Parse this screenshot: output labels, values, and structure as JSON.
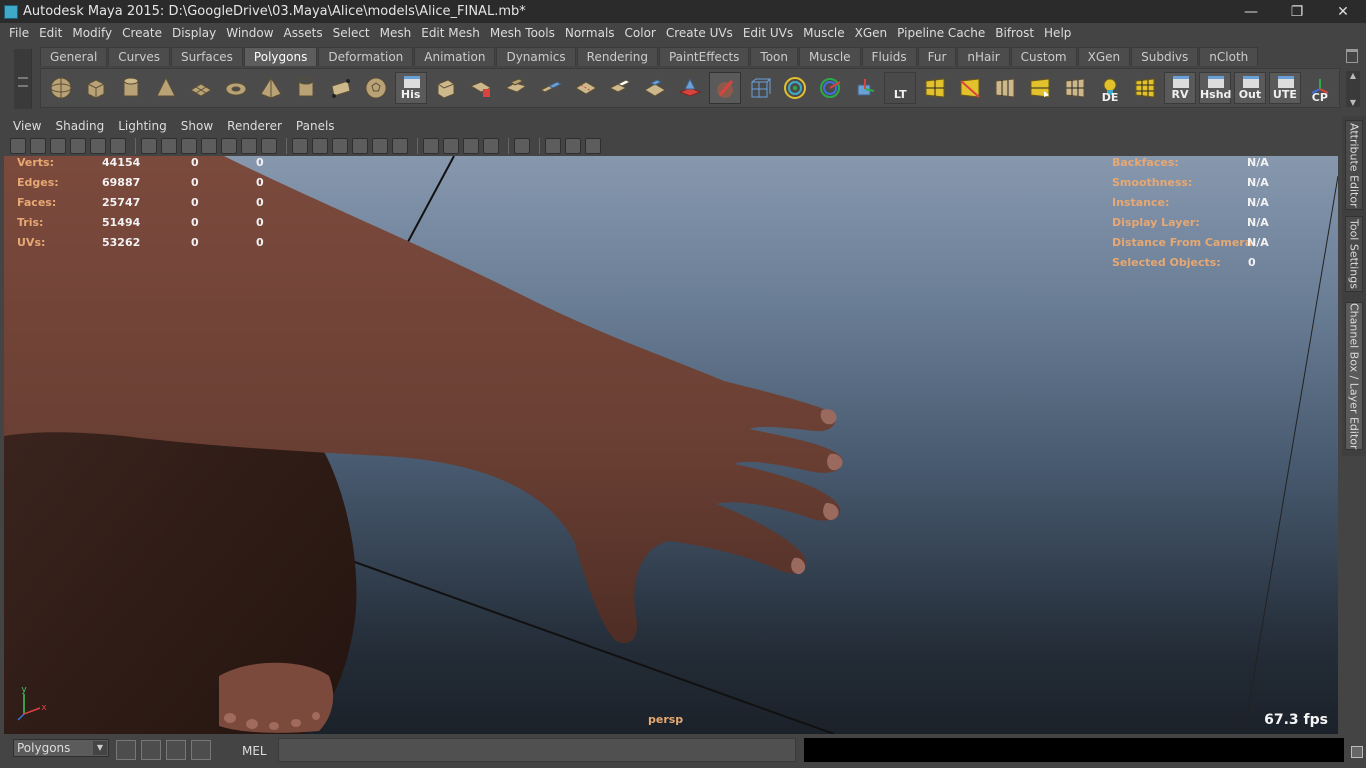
{
  "window": {
    "title": "Autodesk Maya 2015: D:\\GoogleDrive\\03.Maya\\Alice\\models\\Alice_FINAL.mb*",
    "minimize": "—",
    "maximize": "❐",
    "close": "✕"
  },
  "menubar": [
    "File",
    "Edit",
    "Modify",
    "Create",
    "Display",
    "Window",
    "Assets",
    "Select",
    "Mesh",
    "Edit Mesh",
    "Mesh Tools",
    "Normals",
    "Color",
    "Create UVs",
    "Edit UVs",
    "Muscle",
    "XGen",
    "Pipeline Cache",
    "Bifrost",
    "Help"
  ],
  "shelf": {
    "tabs": [
      "General",
      "Curves",
      "Surfaces",
      "Polygons",
      "Deformation",
      "Animation",
      "Dynamics",
      "Rendering",
      "PaintEffects",
      "Toon",
      "Muscle",
      "Fluids",
      "Fur",
      "nHair",
      "Custom",
      "XGen",
      "Subdivs",
      "nCloth"
    ],
    "active_tab": "Polygons",
    "tool_labels": {
      "his": "His",
      "lt": "LT",
      "de": "DE",
      "rv": "RV",
      "hshd": "Hshd",
      "out": "Out",
      "ute": "UTE",
      "cp": "CP"
    }
  },
  "panel": {
    "menus": [
      "View",
      "Shading",
      "Lighting",
      "Show",
      "Renderer",
      "Panels"
    ],
    "camera": "persp",
    "fps": "67.3 fps"
  },
  "hud": {
    "left": [
      {
        "label": "Verts:",
        "v1": "44154",
        "v2": "0",
        "v3": "0"
      },
      {
        "label": "Edges:",
        "v1": "69887",
        "v2": "0",
        "v3": "0"
      },
      {
        "label": "Faces:",
        "v1": "25747",
        "v2": "0",
        "v3": "0"
      },
      {
        "label": "Tris:",
        "v1": "51494",
        "v2": "0",
        "v3": "0"
      },
      {
        "label": "UVs:",
        "v1": "53262",
        "v2": "0",
        "v3": "0"
      }
    ],
    "right": [
      {
        "label": "Backfaces:",
        "value": "N/A"
      },
      {
        "label": "Smoothness:",
        "value": "N/A"
      },
      {
        "label": "Instance:",
        "value": "N/A"
      },
      {
        "label": "Display Layer:",
        "value": "N/A"
      },
      {
        "label": "Distance From Camera:",
        "value": "N/A"
      },
      {
        "label": "Selected Objects:",
        "value": "0"
      }
    ],
    "axis_y": "y",
    "axis_x": "x"
  },
  "side_tabs": [
    "Attribute Editor",
    "Tool Settings",
    "Channel Box / Layer Editor"
  ],
  "cmdline": {
    "mode": "Polygons",
    "mel_label": "MEL"
  },
  "colors": {
    "hud_label": "#e7a873",
    "skin": "#6e4236",
    "viewport_top": "#8798ae",
    "viewport_bottom": "#1b2129"
  }
}
